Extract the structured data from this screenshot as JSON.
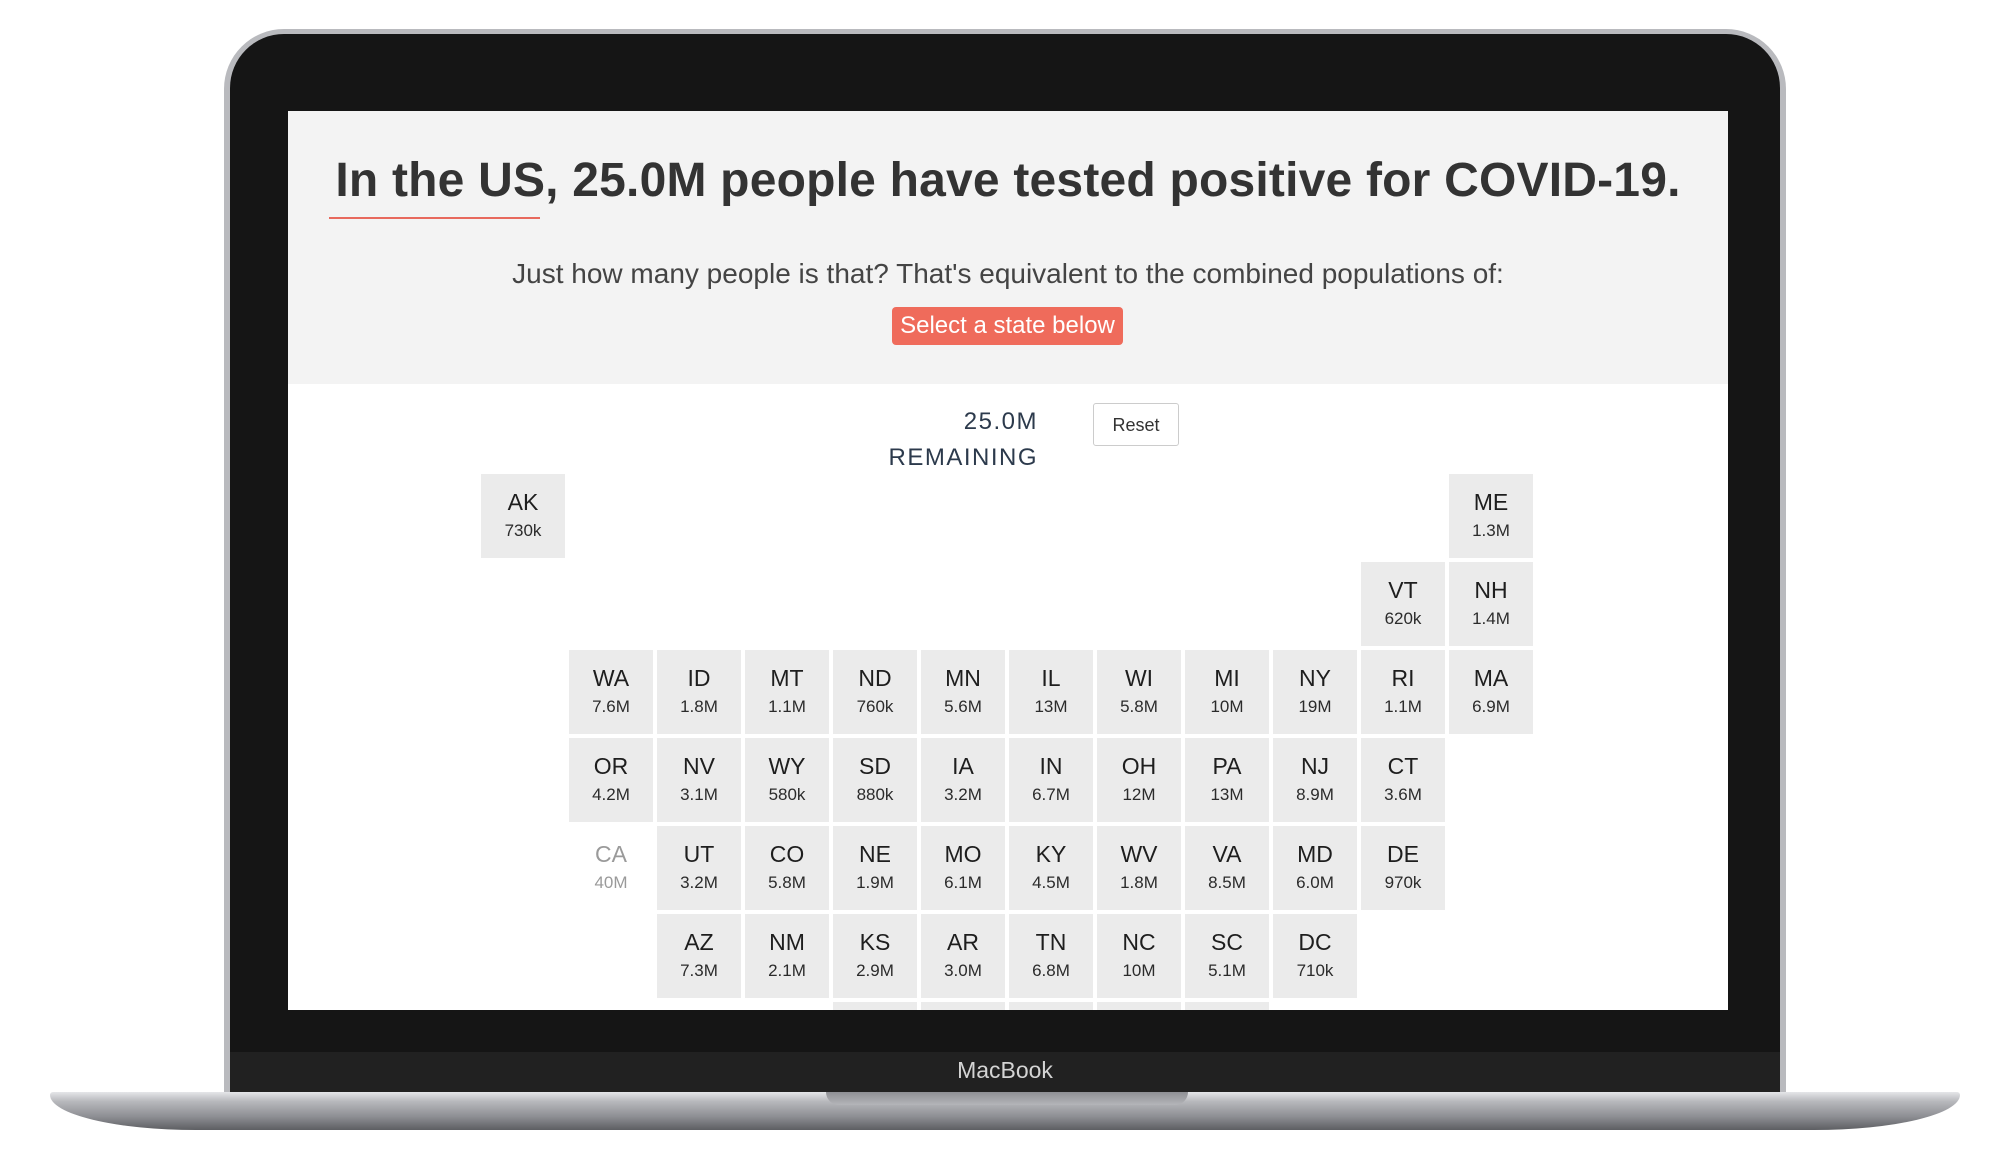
{
  "device": {
    "brand_label": "MacBook"
  },
  "page": {
    "headline": "In the US, 25.0M people have tested positive for COVID-19.",
    "subtext": "Just how many people is that? That's equivalent to the combined populations of:",
    "select_prompt": "Select a state below",
    "remaining_label": "25.0M REMAINING",
    "reset_label": "Reset"
  },
  "colors": {
    "accent": "#ef6b5b",
    "header_bg": "#f3f3f3",
    "tile_bg": "#ebebeb",
    "remaining_text": "#2c3a4c"
  },
  "grid": {
    "rows": [
      [
        {
          "col": 0,
          "abbr": "AK",
          "pop": "730k"
        },
        {
          "col": 11,
          "abbr": "ME",
          "pop": "1.3M"
        }
      ],
      [
        {
          "col": 10,
          "abbr": "VT",
          "pop": "620k"
        },
        {
          "col": 11,
          "abbr": "NH",
          "pop": "1.4M"
        }
      ],
      [
        {
          "col": 1,
          "abbr": "WA",
          "pop": "7.6M"
        },
        {
          "col": 2,
          "abbr": "ID",
          "pop": "1.8M"
        },
        {
          "col": 3,
          "abbr": "MT",
          "pop": "1.1M"
        },
        {
          "col": 4,
          "abbr": "ND",
          "pop": "760k"
        },
        {
          "col": 5,
          "abbr": "MN",
          "pop": "5.6M"
        },
        {
          "col": 6,
          "abbr": "IL",
          "pop": "13M"
        },
        {
          "col": 7,
          "abbr": "WI",
          "pop": "5.8M"
        },
        {
          "col": 8,
          "abbr": "MI",
          "pop": "10M"
        },
        {
          "col": 9,
          "abbr": "NY",
          "pop": "19M"
        },
        {
          "col": 10,
          "abbr": "RI",
          "pop": "1.1M"
        },
        {
          "col": 11,
          "abbr": "MA",
          "pop": "6.9M"
        }
      ],
      [
        {
          "col": 1,
          "abbr": "OR",
          "pop": "4.2M"
        },
        {
          "col": 2,
          "abbr": "NV",
          "pop": "3.1M"
        },
        {
          "col": 3,
          "abbr": "WY",
          "pop": "580k"
        },
        {
          "col": 4,
          "abbr": "SD",
          "pop": "880k"
        },
        {
          "col": 5,
          "abbr": "IA",
          "pop": "3.2M"
        },
        {
          "col": 6,
          "abbr": "IN",
          "pop": "6.7M"
        },
        {
          "col": 7,
          "abbr": "OH",
          "pop": "12M"
        },
        {
          "col": 8,
          "abbr": "PA",
          "pop": "13M"
        },
        {
          "col": 9,
          "abbr": "NJ",
          "pop": "8.9M"
        },
        {
          "col": 10,
          "abbr": "CT",
          "pop": "3.6M"
        }
      ],
      [
        {
          "col": 1,
          "abbr": "CA",
          "pop": "40M",
          "disabled": true
        },
        {
          "col": 2,
          "abbr": "UT",
          "pop": "3.2M"
        },
        {
          "col": 3,
          "abbr": "CO",
          "pop": "5.8M"
        },
        {
          "col": 4,
          "abbr": "NE",
          "pop": "1.9M"
        },
        {
          "col": 5,
          "abbr": "MO",
          "pop": "6.1M"
        },
        {
          "col": 6,
          "abbr": "KY",
          "pop": "4.5M"
        },
        {
          "col": 7,
          "abbr": "WV",
          "pop": "1.8M"
        },
        {
          "col": 8,
          "abbr": "VA",
          "pop": "8.5M"
        },
        {
          "col": 9,
          "abbr": "MD",
          "pop": "6.0M"
        },
        {
          "col": 10,
          "abbr": "DE",
          "pop": "970k"
        }
      ],
      [
        {
          "col": 2,
          "abbr": "AZ",
          "pop": "7.3M"
        },
        {
          "col": 3,
          "abbr": "NM",
          "pop": "2.1M"
        },
        {
          "col": 4,
          "abbr": "KS",
          "pop": "2.9M"
        },
        {
          "col": 5,
          "abbr": "AR",
          "pop": "3.0M"
        },
        {
          "col": 6,
          "abbr": "TN",
          "pop": "6.8M"
        },
        {
          "col": 7,
          "abbr": "NC",
          "pop": "10M"
        },
        {
          "col": 8,
          "abbr": "SC",
          "pop": "5.1M"
        },
        {
          "col": 9,
          "abbr": "DC",
          "pop": "710k"
        }
      ],
      [
        {
          "col": 4,
          "abbr": "",
          "pop": "",
          "partial": true
        },
        {
          "col": 5,
          "abbr": "",
          "pop": "",
          "partial": true
        },
        {
          "col": 6,
          "abbr": "",
          "pop": "",
          "partial": true
        },
        {
          "col": 7,
          "abbr": "",
          "pop": "",
          "partial": true
        },
        {
          "col": 8,
          "abbr": "",
          "pop": "",
          "partial": true
        }
      ]
    ]
  }
}
